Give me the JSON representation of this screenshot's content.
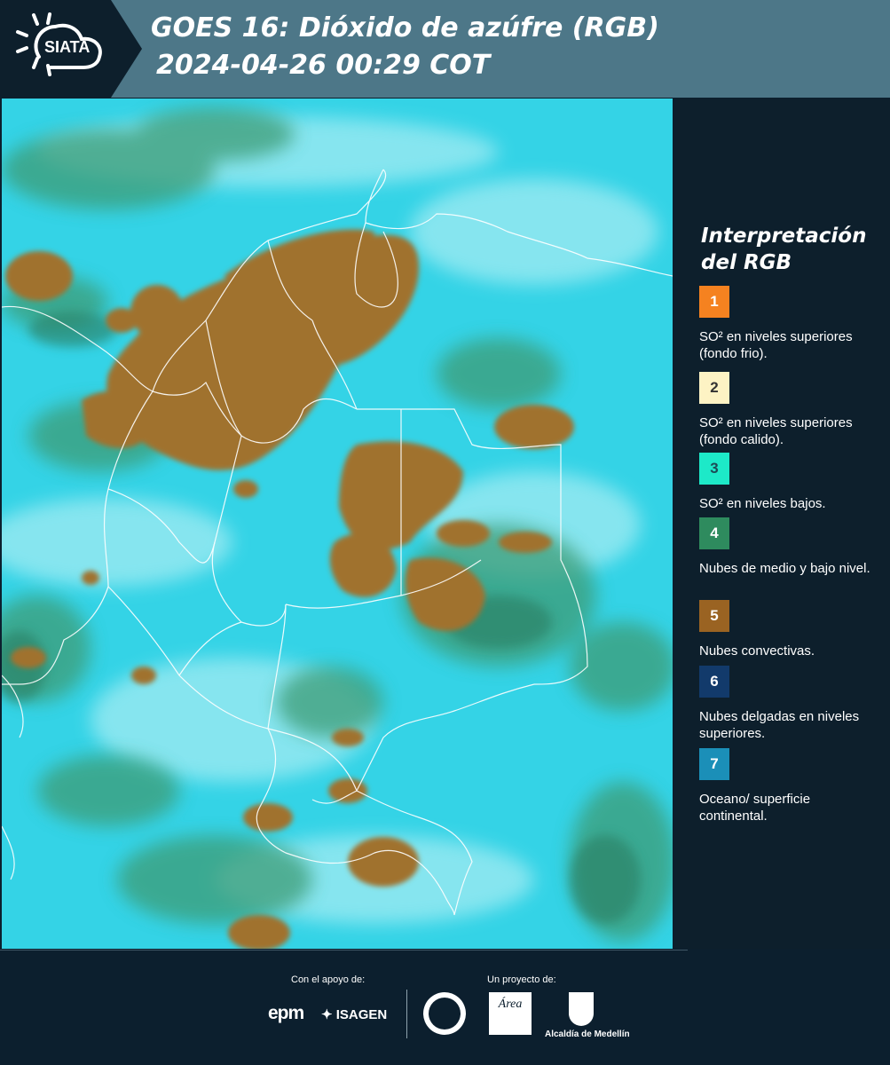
{
  "header": {
    "logo_text": "SIATA",
    "title_line1": "GOES 16: Dióxido de azúfre (RGB)",
    "title_line2": "2024-04-26 00:29 COT"
  },
  "legend": {
    "title_line1": "Interpretación",
    "title_line2": "del RGB",
    "items": [
      {
        "number": "1",
        "color": "#f58220",
        "text_color": "#ffffff",
        "description": "SO² en niveles superiores (fondo frio)."
      },
      {
        "number": "2",
        "color": "#fdf3c4",
        "text_color": "#333333",
        "description": "SO² en niveles superiores (fondo calido)."
      },
      {
        "number": "3",
        "color": "#1de9c8",
        "text_color": "#1d4a55",
        "description": "SO² en niveles bajos."
      },
      {
        "number": "4",
        "color": "#2e8b5e",
        "text_color": "#ffffff",
        "description": "Nubes de medio y bajo nivel."
      },
      {
        "number": "5",
        "color": "#9a6322",
        "text_color": "#ffffff",
        "description": "Nubes convectivas."
      },
      {
        "number": "6",
        "color": "#123a6b",
        "text_color": "#ffffff",
        "description": "Nubes delgadas en niveles superiores."
      },
      {
        "number": "7",
        "color": "#1b8fb8",
        "text_color": "#ffffff",
        "description": "Oceano/ superficie continental."
      }
    ]
  },
  "footer": {
    "support_label": "Con el apoyo de:",
    "project_label": "Un proyecto de:",
    "sponsor_1": "epm",
    "sponsor_2": "ISAGEN",
    "partner_area": "Área",
    "partner_alcaldia": "Alcaldía de Medellín"
  },
  "map": {
    "colors": {
      "background": "#34d3e6",
      "convective": "#a0722f",
      "low_cloud": "#3e9c76",
      "boundaries": "#ffffff"
    }
  }
}
